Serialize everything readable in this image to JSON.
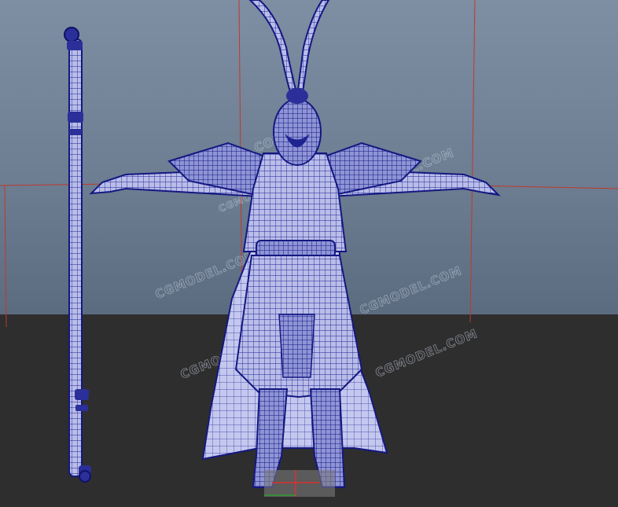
{
  "watermarks": {
    "w1": "CGMODEL.COM",
    "w2": "CGMODEL.COM",
    "w3": "CGMODEL.COM",
    "w4": "CGMODEL.COM",
    "w5": "CGMODEL.COM",
    "w6": "CGMODEL.COM",
    "w7": "CGMODEL.COM"
  },
  "colors": {
    "wire": "#1a1d8a",
    "wire_light": "#c9ccf0",
    "grid_line": "#c0392b",
    "sky": "#7e8ea3",
    "floor": "#2e2e2e"
  }
}
